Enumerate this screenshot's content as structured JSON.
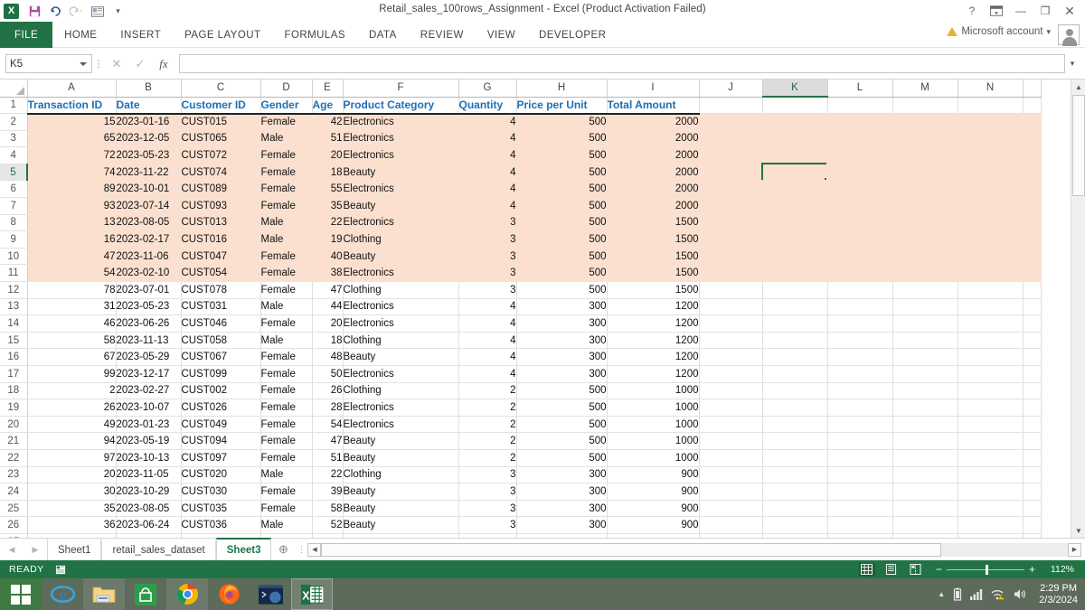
{
  "window": {
    "title": "Retail_sales_100rows_Assignment - Excel (Product Activation Failed)",
    "app_logo": "X",
    "help_label": "?",
    "ribbon_display_label": "ribbon-display-options",
    "minimize_label": "—",
    "restore_label": "❐",
    "close_label": "✕"
  },
  "quick_access": [
    {
      "name": "save-icon",
      "glyph": "▤"
    },
    {
      "name": "undo-icon",
      "glyph": "↶"
    },
    {
      "name": "redo-icon",
      "glyph": "↷"
    },
    {
      "name": "camera-icon",
      "glyph": "▣"
    },
    {
      "name": "customize-qat-icon",
      "glyph": "▾"
    }
  ],
  "ribbon": {
    "tabs": [
      {
        "label": "FILE",
        "active": true
      },
      {
        "label": "HOME",
        "active": false
      },
      {
        "label": "INSERT",
        "active": false
      },
      {
        "label": "PAGE LAYOUT",
        "active": false
      },
      {
        "label": "FORMULAS",
        "active": false
      },
      {
        "label": "DATA",
        "active": false
      },
      {
        "label": "REVIEW",
        "active": false
      },
      {
        "label": "VIEW",
        "active": false
      },
      {
        "label": "DEVELOPER",
        "active": false
      }
    ],
    "account_label": "Microsoft account",
    "account_caret": "▾"
  },
  "formula_bar": {
    "name_box_value": "K5",
    "cancel_label": "✕",
    "enter_label": "✓",
    "fx_label": "fx",
    "formula_value": "",
    "expand_caret": "▾"
  },
  "grid": {
    "columns": [
      "A",
      "B",
      "C",
      "D",
      "E",
      "F",
      "G",
      "H",
      "I",
      "J",
      "K",
      "L",
      "M",
      "N"
    ],
    "selected_column": "K",
    "selected_row": 5,
    "selected_cell": "K5",
    "headers": [
      "Transaction ID",
      "Date",
      "Customer ID",
      "Gender",
      "Age",
      "Product Category",
      "Quantity",
      "Price per Unit",
      "Total Amount"
    ],
    "rows": [
      {
        "n": 2,
        "hl": true,
        "cells": [
          "15",
          "2023-01-16",
          "CUST015",
          "Female",
          "42",
          "Electronics",
          "4",
          "500",
          "2000"
        ]
      },
      {
        "n": 3,
        "hl": true,
        "cells": [
          "65",
          "2023-12-05",
          "CUST065",
          "Male",
          "51",
          "Electronics",
          "4",
          "500",
          "2000"
        ]
      },
      {
        "n": 4,
        "hl": true,
        "cells": [
          "72",
          "2023-05-23",
          "CUST072",
          "Female",
          "20",
          "Electronics",
          "4",
          "500",
          "2000"
        ]
      },
      {
        "n": 5,
        "hl": true,
        "cells": [
          "74",
          "2023-11-22",
          "CUST074",
          "Female",
          "18",
          "Beauty",
          "4",
          "500",
          "2000"
        ]
      },
      {
        "n": 6,
        "hl": true,
        "cells": [
          "89",
          "2023-10-01",
          "CUST089",
          "Female",
          "55",
          "Electronics",
          "4",
          "500",
          "2000"
        ]
      },
      {
        "n": 7,
        "hl": true,
        "cells": [
          "93",
          "2023-07-14",
          "CUST093",
          "Female",
          "35",
          "Beauty",
          "4",
          "500",
          "2000"
        ]
      },
      {
        "n": 8,
        "hl": true,
        "cells": [
          "13",
          "2023-08-05",
          "CUST013",
          "Male",
          "22",
          "Electronics",
          "3",
          "500",
          "1500"
        ]
      },
      {
        "n": 9,
        "hl": true,
        "cells": [
          "16",
          "2023-02-17",
          "CUST016",
          "Male",
          "19",
          "Clothing",
          "3",
          "500",
          "1500"
        ]
      },
      {
        "n": 10,
        "hl": true,
        "cells": [
          "47",
          "2023-11-06",
          "CUST047",
          "Female",
          "40",
          "Beauty",
          "3",
          "500",
          "1500"
        ]
      },
      {
        "n": 11,
        "hl": true,
        "cells": [
          "54",
          "2023-02-10",
          "CUST054",
          "Female",
          "38",
          "Electronics",
          "3",
          "500",
          "1500"
        ]
      },
      {
        "n": 12,
        "hl": false,
        "cells": [
          "78",
          "2023-07-01",
          "CUST078",
          "Female",
          "47",
          "Clothing",
          "3",
          "500",
          "1500"
        ]
      },
      {
        "n": 13,
        "hl": false,
        "cells": [
          "31",
          "2023-05-23",
          "CUST031",
          "Male",
          "44",
          "Electronics",
          "4",
          "300",
          "1200"
        ]
      },
      {
        "n": 14,
        "hl": false,
        "cells": [
          "46",
          "2023-06-26",
          "CUST046",
          "Female",
          "20",
          "Electronics",
          "4",
          "300",
          "1200"
        ]
      },
      {
        "n": 15,
        "hl": false,
        "cells": [
          "58",
          "2023-11-13",
          "CUST058",
          "Male",
          "18",
          "Clothing",
          "4",
          "300",
          "1200"
        ]
      },
      {
        "n": 16,
        "hl": false,
        "cells": [
          "67",
          "2023-05-29",
          "CUST067",
          "Female",
          "48",
          "Beauty",
          "4",
          "300",
          "1200"
        ]
      },
      {
        "n": 17,
        "hl": false,
        "cells": [
          "99",
          "2023-12-17",
          "CUST099",
          "Female",
          "50",
          "Electronics",
          "4",
          "300",
          "1200"
        ]
      },
      {
        "n": 18,
        "hl": false,
        "cells": [
          "2",
          "2023-02-27",
          "CUST002",
          "Female",
          "26",
          "Clothing",
          "2",
          "500",
          "1000"
        ]
      },
      {
        "n": 19,
        "hl": false,
        "cells": [
          "26",
          "2023-10-07",
          "CUST026",
          "Female",
          "28",
          "Electronics",
          "2",
          "500",
          "1000"
        ]
      },
      {
        "n": 20,
        "hl": false,
        "cells": [
          "49",
          "2023-01-23",
          "CUST049",
          "Female",
          "54",
          "Electronics",
          "2",
          "500",
          "1000"
        ]
      },
      {
        "n": 21,
        "hl": false,
        "cells": [
          "94",
          "2023-05-19",
          "CUST094",
          "Female",
          "47",
          "Beauty",
          "2",
          "500",
          "1000"
        ]
      },
      {
        "n": 22,
        "hl": false,
        "cells": [
          "97",
          "2023-10-13",
          "CUST097",
          "Female",
          "51",
          "Beauty",
          "2",
          "500",
          "1000"
        ]
      },
      {
        "n": 23,
        "hl": false,
        "cells": [
          "20",
          "2023-11-05",
          "CUST020",
          "Male",
          "22",
          "Clothing",
          "3",
          "300",
          "900"
        ]
      },
      {
        "n": 24,
        "hl": false,
        "cells": [
          "30",
          "2023-10-29",
          "CUST030",
          "Female",
          "39",
          "Beauty",
          "3",
          "300",
          "900"
        ]
      },
      {
        "n": 25,
        "hl": false,
        "cells": [
          "35",
          "2023-08-05",
          "CUST035",
          "Female",
          "58",
          "Beauty",
          "3",
          "300",
          "900"
        ]
      },
      {
        "n": 26,
        "hl": false,
        "cells": [
          "36",
          "2023-06-24",
          "CUST036",
          "Male",
          "52",
          "Beauty",
          "3",
          "300",
          "900"
        ]
      }
    ],
    "highlight_color": "#fbe0d0",
    "header_text_color": "#1f6fb5",
    "selection_color": "#217346"
  },
  "sheet_tabs": {
    "first_label": "◀",
    "prev_label": "◀",
    "next_label": "▶",
    "last_label": "▶",
    "tabs": [
      {
        "label": "Sheet1",
        "active": false
      },
      {
        "label": "retail_sales_dataset",
        "active": false
      },
      {
        "label": "Sheet3",
        "active": true
      }
    ],
    "add_sheet_label": "⊕"
  },
  "status_bar": {
    "mode": "READY",
    "macro_icon": "▦",
    "views": [
      {
        "name": "normal-view",
        "glyph": "▦",
        "active": true
      },
      {
        "name": "page-layout-view",
        "glyph": "▤",
        "active": false
      },
      {
        "name": "page-break-view",
        "glyph": "▥",
        "active": false
      }
    ],
    "zoom_out_label": "−",
    "zoom_in_label": "+",
    "zoom_level": "112%"
  },
  "taskbar": {
    "start_label": "start-button",
    "items": [
      {
        "name": "internet-explorer-icon",
        "glyph": "e"
      },
      {
        "name": "file-explorer-icon",
        "glyph": "▤"
      },
      {
        "name": "store-icon",
        "glyph": "▣"
      },
      {
        "name": "chrome-icon",
        "glyph": "◎"
      },
      {
        "name": "firefox-icon",
        "glyph": "◉"
      },
      {
        "name": "python-terminal-icon",
        "glyph": "▪"
      },
      {
        "name": "excel-icon",
        "glyph": "X"
      }
    ],
    "tray": [
      {
        "name": "show-hidden-icons",
        "glyph": "▲"
      },
      {
        "name": "battery-icon",
        "glyph": "▮"
      },
      {
        "name": "network-signal-icon",
        "glyph": "▂▄▆"
      },
      {
        "name": "action-center-warning-icon",
        "glyph": "⚑"
      },
      {
        "name": "volume-icon",
        "glyph": "🔊"
      }
    ],
    "clock_time": "2:29 PM",
    "clock_date": "2/3/2024"
  }
}
